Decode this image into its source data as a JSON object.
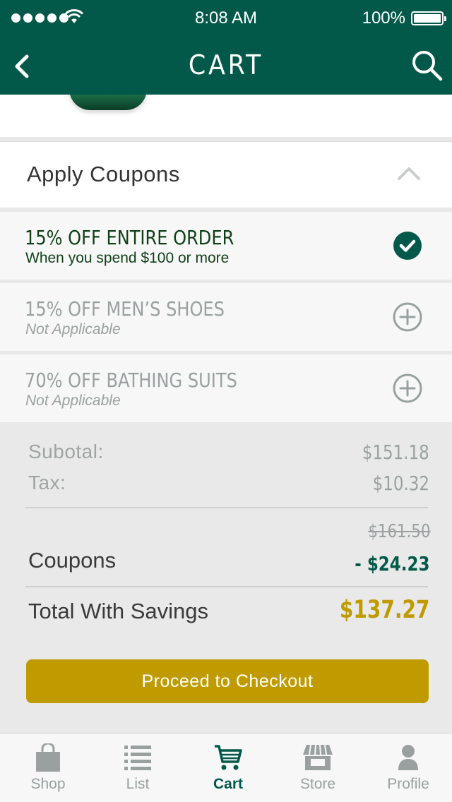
{
  "status_bar": {
    "time": "8:08 AM",
    "battery": "100%"
  },
  "nav": {
    "title": "CART"
  },
  "apply_coupons": {
    "label": "Apply Coupons"
  },
  "coupons": [
    {
      "title": "15% OFF ENTIRE ORDER",
      "subtitle": "When you spend $100 or more",
      "state": "applied"
    },
    {
      "title": "15% OFF MEN’S SHOES",
      "subtitle": "Not Applicable",
      "state": "available"
    },
    {
      "title": "70% OFF BATHING SUITS",
      "subtitle": "Not Applicable",
      "state": "available"
    }
  ],
  "summary": {
    "subtotal_label": "Subotal:",
    "subtotal_value": "$151.18",
    "tax_label": "Tax:",
    "tax_value": "$10.32",
    "original_total": "$161.50",
    "coupons_label": "Coupons",
    "coupons_value": "- $24.23",
    "total_label": "Total With Savings",
    "total_value": "$137.27"
  },
  "checkout": {
    "label": "Proceed to Checkout"
  },
  "tabs": [
    {
      "label": "Shop",
      "icon": "bag-icon"
    },
    {
      "label": "List",
      "icon": "list-icon"
    },
    {
      "label": "Cart",
      "icon": "cart-icon",
      "active": true
    },
    {
      "label": "Store",
      "icon": "store-icon"
    },
    {
      "label": "Profile",
      "icon": "profile-icon"
    }
  ],
  "colors": {
    "brand": "#02594a",
    "accent": "#c09b00",
    "inactive": "#9aa0a0"
  }
}
